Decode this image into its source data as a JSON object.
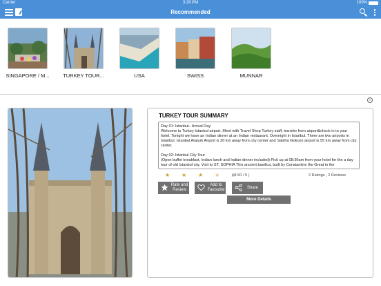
{
  "status_bar": {
    "carrier": "Carrier",
    "time": "3:28 PM",
    "battery": "100%"
  },
  "nav": {
    "title": "Recommended"
  },
  "categories": [
    {
      "label": "SINGAPORE / M..."
    },
    {
      "label": "TURKEY TOUR..."
    },
    {
      "label": "USA"
    },
    {
      "label": "SWISS"
    },
    {
      "label": "MUNNAR"
    }
  ],
  "summary": {
    "title": "TURKEY TOUR SUMMARY",
    "description": [
      "Day 01: Istanbul– Arrival Day\nWelcome to Turkey Istanbul airport. Meet with Travel Shop Turkey staff, transfer from airport&check in to your hotel. Tonight we have an Indian dinner at an Indian restaurant. Overnight in Istanbul. There are two airports in Istanbul. Istanbul Ataturk Airport is 20 km away from city center and Sabiha Gokcen airport is 55 km away from city center.",
      "Day 02: Istanbul City Tour\n(Open buffet breakfast, Indian lunch and Indian dinner included) Pick up at 08:30am from your hotel for the a day tour of old Istanbul city. Visit to ST. SOPHIA This ancient basilica, built by Constantine the Great in the"
    ],
    "rating_value": "( 3.50 / 5 )",
    "rating_count": "2 Ratings , 2 Reviews",
    "rating_stars": 3.5,
    "rate_label": "Rate and Review",
    "fav_label": "Add to Favourite",
    "share_label": "Share",
    "more_label": "More Details"
  },
  "colors": {
    "accent": "#4a90d9",
    "button": "#707070",
    "star": "#c9a227"
  }
}
